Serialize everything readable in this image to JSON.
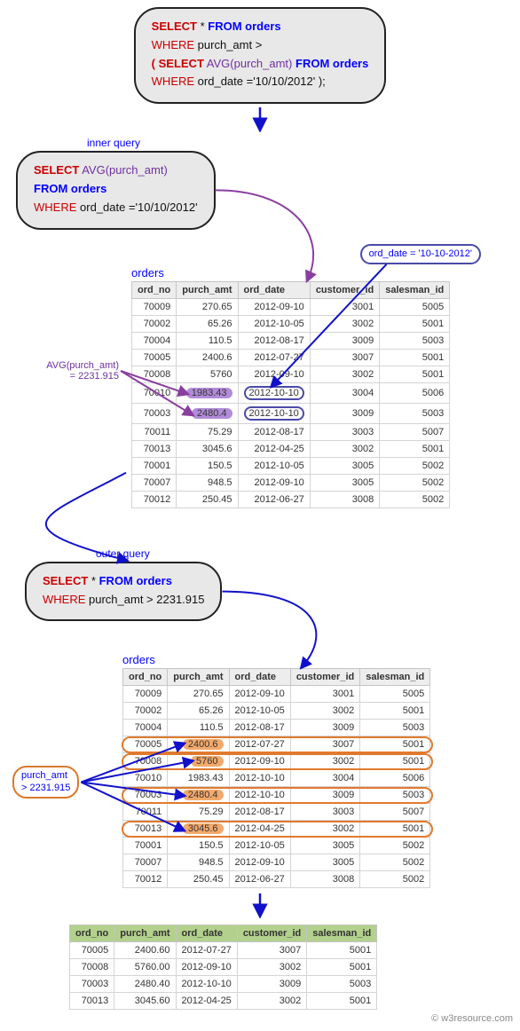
{
  "sql_main": {
    "line1_a": "SELECT",
    "line1_b": "*",
    "line1_c": "FROM orders",
    "line2_a": "WHERE",
    "line2_b": "purch_amt >",
    "line3_a": "( SELECT",
    "line3_b": "AVG(purch_amt)",
    "line3_c": "FROM orders",
    "line4_a": "WHERE",
    "line4_b": "ord_date ='10/10/2012' );"
  },
  "labels": {
    "inner": "inner query",
    "outer": "outer query",
    "table": "orders",
    "avg": "AVG(purch_amt)\n= 2231.915",
    "orddate": "ord_date = '10-10-2012'",
    "purch_gt": "purch_amt\n> 2231.915"
  },
  "sql_inner": {
    "line1_a": "SELECT",
    "line1_b": "AVG(purch_amt)",
    "line2_a": "FROM orders",
    "line3_a": "WHERE",
    "line3_b": "ord_date ='10/10/2012'"
  },
  "sql_outer": {
    "line1_a": "SELECT",
    "line1_b": "*",
    "line1_c": "FROM orders",
    "line2_a": "WHERE",
    "line2_b": "purch_amt > 2231.915"
  },
  "cols": [
    "ord_no",
    "purch_amt",
    "ord_date",
    "customer_id",
    "salesman_id"
  ],
  "chart_data": {
    "type": "table",
    "title": "orders",
    "columns": [
      "ord_no",
      "purch_amt",
      "ord_date",
      "customer_id",
      "salesman_id"
    ],
    "rows": [
      {
        "ord_no": 70009,
        "purch_amt": 270.65,
        "ord_date": "2012-09-10",
        "customer_id": 3001,
        "salesman_id": 5005
      },
      {
        "ord_no": 70002,
        "purch_amt": 65.26,
        "ord_date": "2012-10-05",
        "customer_id": 3002,
        "salesman_id": 5001
      },
      {
        "ord_no": 70004,
        "purch_amt": 110.5,
        "ord_date": "2012-08-17",
        "customer_id": 3009,
        "salesman_id": 5003
      },
      {
        "ord_no": 70005,
        "purch_amt": 2400.6,
        "ord_date": "2012-07-27",
        "customer_id": 3007,
        "salesman_id": 5001
      },
      {
        "ord_no": 70008,
        "purch_amt": 5760,
        "ord_date": "2012-09-10",
        "customer_id": 3002,
        "salesman_id": 5001
      },
      {
        "ord_no": 70010,
        "purch_amt": 1983.43,
        "ord_date": "2012-10-10",
        "customer_id": 3004,
        "salesman_id": 5006
      },
      {
        "ord_no": 70003,
        "purch_amt": 2480.4,
        "ord_date": "2012-10-10",
        "customer_id": 3009,
        "salesman_id": 5003
      },
      {
        "ord_no": 70011,
        "purch_amt": 75.29,
        "ord_date": "2012-08-17",
        "customer_id": 3003,
        "salesman_id": 5007
      },
      {
        "ord_no": 70013,
        "purch_amt": 3045.6,
        "ord_date": "2012-04-25",
        "customer_id": 3002,
        "salesman_id": 5001
      },
      {
        "ord_no": 70001,
        "purch_amt": 150.5,
        "ord_date": "2012-10-05",
        "customer_id": 3005,
        "salesman_id": 5002
      },
      {
        "ord_no": 70007,
        "purch_amt": 948.5,
        "ord_date": "2012-09-10",
        "customer_id": 3005,
        "salesman_id": 5002
      },
      {
        "ord_no": 70012,
        "purch_amt": 250.45,
        "ord_date": "2012-06-27",
        "customer_id": 3008,
        "salesman_id": 5002
      }
    ],
    "inner_avg_rows": [
      70010,
      70003
    ],
    "inner_avg_value": 2231.915,
    "outer_filter_rows": [
      70005,
      70008,
      70003,
      70013
    ],
    "result": [
      {
        "ord_no": 70005,
        "purch_amt": "2400.60",
        "ord_date": "2012-07-27",
        "customer_id": 3007,
        "salesman_id": 5001
      },
      {
        "ord_no": 70008,
        "purch_amt": "5760.00",
        "ord_date": "2012-09-10",
        "customer_id": 3002,
        "salesman_id": 5001
      },
      {
        "ord_no": 70003,
        "purch_amt": "2480.40",
        "ord_date": "2012-10-10",
        "customer_id": 3009,
        "salesman_id": 5003
      },
      {
        "ord_no": 70013,
        "purch_amt": "3045.60",
        "ord_date": "2012-04-25",
        "customer_id": 3002,
        "salesman_id": 5001
      }
    ]
  },
  "credit": "© w3resource.com"
}
